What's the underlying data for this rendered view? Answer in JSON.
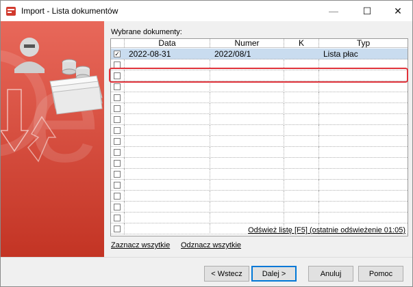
{
  "window": {
    "title": "Import - Lista dokumentów",
    "minimize_glyph": "—",
    "maximize_glyph": "☐",
    "close_glyph": "✕"
  },
  "main": {
    "list_label": "Wybrane dokumenty:",
    "columns": [
      "Data",
      "Numer",
      "K",
      "Typ"
    ],
    "rows": [
      {
        "checked": true,
        "check_glyph": "✓",
        "data": "2022-08-31",
        "numer": "2022/08/1",
        "k": "",
        "typ": "Lista płac"
      }
    ],
    "refresh_link": "Odśwież listę [F5] (ostatnie odświeżenie 01:05)",
    "select_all": "Zaznacz wszytkie",
    "deselect_all": "Odznacz wszytkie"
  },
  "footer": {
    "back_label": "< Wstecz",
    "next_label": "Dalej >",
    "cancel_label": "Anuluj",
    "help_label": "Pomoc"
  },
  "colors": {
    "side_panel": "#c83a28",
    "selection_row": "#c9dcef",
    "highlight_outline": "#e0323a"
  }
}
